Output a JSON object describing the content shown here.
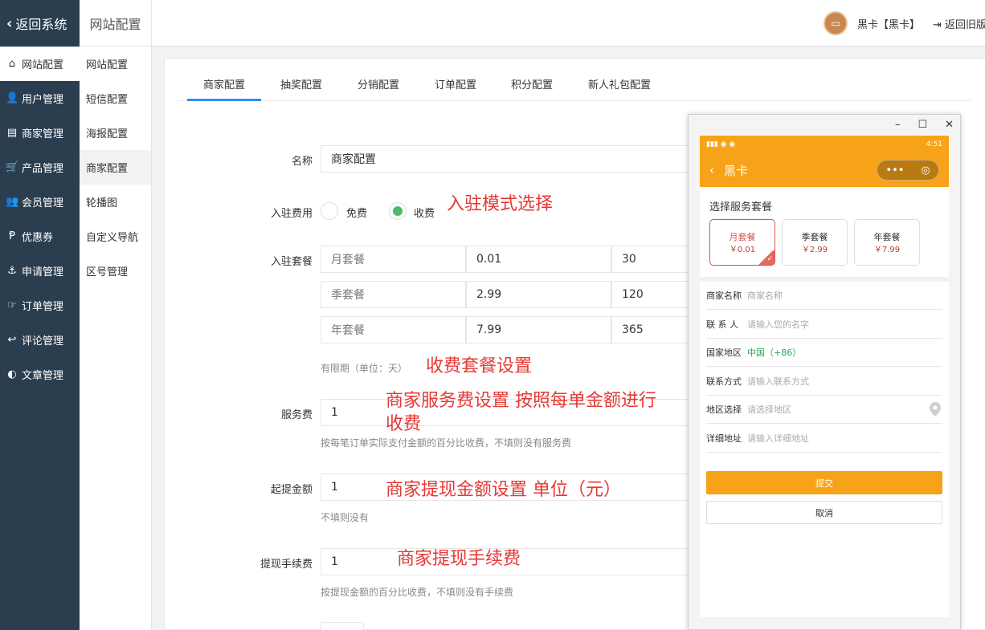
{
  "header": {
    "back_label": "返回系统",
    "crumb": "网站配置",
    "user": "黑卡【黑卡】",
    "logout": "返回旧版"
  },
  "leftnav": [
    {
      "label": "网站配置",
      "icon": "home-icon",
      "glyph": "⌂",
      "active": true
    },
    {
      "label": "用户管理",
      "icon": "user-icon",
      "glyph": "👤"
    },
    {
      "label": "商家管理",
      "icon": "server-icon",
      "glyph": "▤"
    },
    {
      "label": "产品管理",
      "icon": "cart-icon",
      "glyph": "🛒"
    },
    {
      "label": "会员管理",
      "icon": "users-icon",
      "glyph": "👥"
    },
    {
      "label": "优惠券",
      "icon": "coupon-icon",
      "glyph": "Ᵽ"
    },
    {
      "label": "申请管理",
      "icon": "anchor-icon",
      "glyph": "⚓"
    },
    {
      "label": "订单管理",
      "icon": "hand-icon",
      "glyph": "☞"
    },
    {
      "label": "评论管理",
      "icon": "reply-icon",
      "glyph": "↩"
    },
    {
      "label": "文章管理",
      "icon": "contrast-icon",
      "glyph": "◐"
    }
  ],
  "subnav": [
    {
      "label": "网站配置"
    },
    {
      "label": "短信配置"
    },
    {
      "label": "海报配置"
    },
    {
      "label": "商家配置",
      "active": true
    },
    {
      "label": "轮播图"
    },
    {
      "label": "自定义导航"
    },
    {
      "label": "区号管理"
    }
  ],
  "tabs": [
    "商家配置",
    "抽奖配置",
    "分销配置",
    "订单配置",
    "积分配置",
    "新人礼包配置"
  ],
  "form": {
    "name_label": "名称",
    "name_value": "商家配置",
    "fee_label": "入驻费用",
    "fee_free": "免费",
    "fee_paid": "收费",
    "pkg_label": "入驻套餐",
    "packages": [
      {
        "name": "月套餐",
        "price": "0.01",
        "days": "30"
      },
      {
        "name": "季套餐",
        "price": "2.99",
        "days": "120"
      },
      {
        "name": "年套餐",
        "price": "7.99",
        "days": "365"
      }
    ],
    "pkg_hint": "有限期（单位：天）",
    "service_label": "服务费",
    "service_value": "1",
    "service_hint": "按每笔订单实际支付金额的百分比收费，不填则没有服务费",
    "withdraw_label": "起提金额",
    "withdraw_value": "1",
    "withdraw_hint": "不填则没有",
    "wfee_label": "提现手续费",
    "wfee_value": "1",
    "wfee_hint": "按提现金额的百分比收费，不填则没有手续费"
  },
  "annotations": {
    "mode": "入驻模式选择",
    "pkg": "收费套餐设置",
    "service_1": "商家服务费设置 按照每单金额进行",
    "service_2": "收费",
    "withdraw": "商家提现金额设置 单位（元）",
    "wfee": "商家提现手续费"
  },
  "phone": {
    "time": "4:51",
    "title": "黑卡",
    "section": "选择服务套餐",
    "packages": [
      {
        "name": "月套餐",
        "price": "￥0.01",
        "selected": true
      },
      {
        "name": "季套餐",
        "price": "￥2.99"
      },
      {
        "name": "年套餐",
        "price": "￥7.99"
      }
    ],
    "fields": [
      {
        "label": "商家名称",
        "value": "商家名称"
      },
      {
        "label": "联 系 人",
        "value": "请输入您的名字"
      },
      {
        "label": "国家地区",
        "value": "中国（+86）",
        "green": true
      },
      {
        "label": "联系方式",
        "value": "请输入联系方式"
      },
      {
        "label": "地区选择",
        "value": "请选择地区",
        "pin": true
      },
      {
        "label": "详细地址",
        "value": "请输入详细地址"
      }
    ],
    "submit": "提交",
    "cancel": "取消"
  },
  "colors": {
    "sidebar": "#2b3e50",
    "accent_blue": "#2d8cf0",
    "radio_on": "#4cbb6c",
    "annotation_red": "#e53935",
    "phone_orange": "#f7a31a"
  }
}
